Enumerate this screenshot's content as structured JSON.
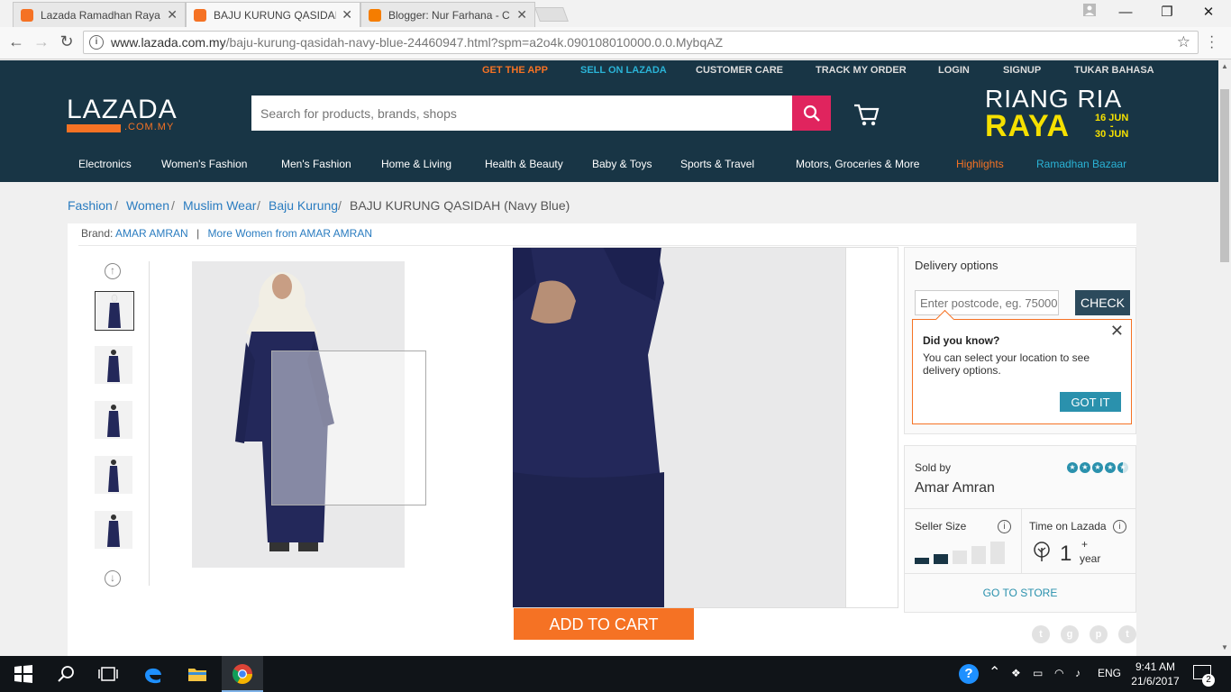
{
  "browser": {
    "tabs": [
      {
        "title": "Lazada Ramadhan Raya",
        "active": false
      },
      {
        "title": "BAJU KURUNG QASIDAH",
        "active": true
      },
      {
        "title": "Blogger: Nur Farhana - C",
        "active": false
      }
    ],
    "url_domain": "www.lazada.com.my",
    "url_path": "/baju-kurung-qasidah-navy-blue-24460947.html?spm=a2o4k.090108010000.0.0.MybqAZ"
  },
  "topbar": {
    "get_app": "GET THE APP",
    "sell": "SELL ON LAZADA",
    "care": "CUSTOMER CARE",
    "track": "TRACK MY ORDER",
    "login": "LOGIN",
    "signup": "SIGNUP",
    "language": "TUKAR BAHASA"
  },
  "header": {
    "logo": "LAZADA",
    "logo_sub": ".COM.MY",
    "search_placeholder": "Search for products, brands, shops",
    "promo_line1": "RIANG RIA",
    "promo_line2": "RAYA",
    "promo_date1": "16 JUN",
    "promo_dash": "-",
    "promo_date2": "30 JUN"
  },
  "categories": [
    "Electronics",
    "Women's Fashion",
    "Men's Fashion",
    "Home & Living",
    "Health & Beauty",
    "Baby & Toys",
    "Sports & Travel",
    "Motors, Groceries & More",
    "Highlights",
    "Ramadhan Bazaar"
  ],
  "breadcrumb": {
    "items": [
      "Fashion",
      "Women",
      "Muslim Wear",
      "Baju Kurung"
    ],
    "sep": "/",
    "current": "BAJU KURUNG QASIDAH (Navy Blue)"
  },
  "product": {
    "brand_label": "Brand:",
    "brand": "AMAR AMRAN",
    "brand_sep": "|",
    "more": "More Women from AMAR AMRAN",
    "add_to_cart": "ADD TO CART"
  },
  "delivery": {
    "title": "Delivery options",
    "postcode_placeholder": "Enter postcode, eg. 75000",
    "check": "CHECK",
    "tip_title": "Did you know?",
    "tip_body": "You can select your location to see delivery options.",
    "got_it": "GOT IT"
  },
  "seller": {
    "sold_by": "Sold by",
    "name": "Amar Amran",
    "rating_of_5": 4.5,
    "size_label": "Seller Size",
    "size_level_of_5": 2,
    "time_label": "Time on Lazada",
    "time_value": "1",
    "time_plus": "+",
    "time_unit": "year",
    "go_to_store": "GO TO STORE"
  },
  "taskbar": {
    "lang": "ENG",
    "time": "9:41 AM",
    "date": "21/6/2017",
    "notif_count": "2"
  },
  "colors": {
    "header": "#183545",
    "orange": "#f57224",
    "teal": "#2a91ad",
    "search_btn": "#e0245e",
    "promo_yellow": "#f5e000"
  }
}
